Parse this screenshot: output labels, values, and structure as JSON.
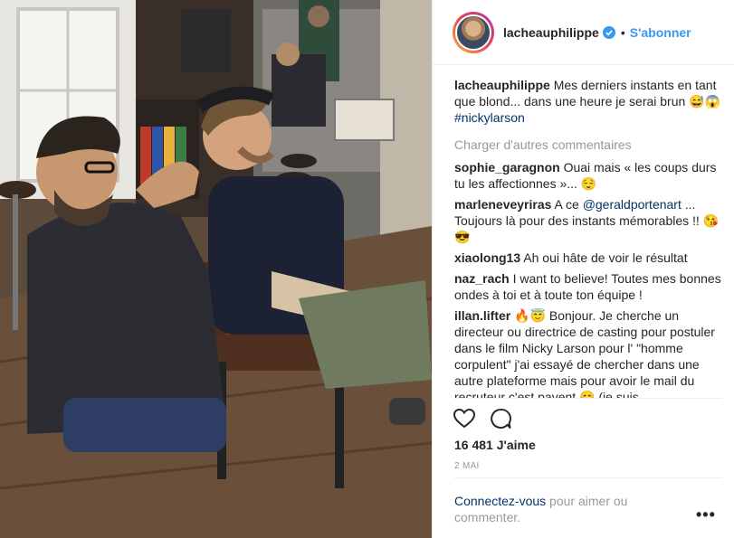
{
  "post": {
    "username": "lacheauphilippe",
    "verified_icon": "verified-badge-icon",
    "separator": "•",
    "follow_label": "S'abonner"
  },
  "caption": {
    "username": "lacheauphilippe",
    "text": "Mes derniers instants en tant que blond... dans une heure je serai brun 😅😱",
    "hashtag": "#nickylarson"
  },
  "load_more_label": "Charger d'autres commentaires",
  "comments": [
    {
      "user": "sophie_garagnon",
      "text": "Ouai mais « les coups durs tu les affectionnes »... 😌"
    },
    {
      "user": "marleneveyriras",
      "text_before": "A ce",
      "mention": "@geraldportenart",
      "text_after": "... Toujours là pour des instants mémorables !! 😘😎"
    },
    {
      "user": "xiaolong13",
      "text": "Ah oui hâte de voir le résultat"
    },
    {
      "user": "naz_rach",
      "text": "I want to believe! Toutes mes bonnes ondes à toi et à toute ton équipe !"
    },
    {
      "user": "illan.lifter",
      "text": "🔥😇 Bonjour. Je cherche un directeur ou directrice de casting pour postuler dans le film Nicky Larson pour l' \"homme corpulent\" j'ai essayé de chercher dans une autre plateforme mais pour avoir le mail du recruteur c'est pavent 😊 (je suis"
    }
  ],
  "actions": {
    "like_icon": "heart-icon",
    "comment_icon": "comment-icon"
  },
  "likes_text": "16 481 J'aime",
  "date_text": "2 MAI",
  "login": {
    "link": "Connectez-vous",
    "rest": " pour aimer ou commenter."
  },
  "more_options": "•••"
}
